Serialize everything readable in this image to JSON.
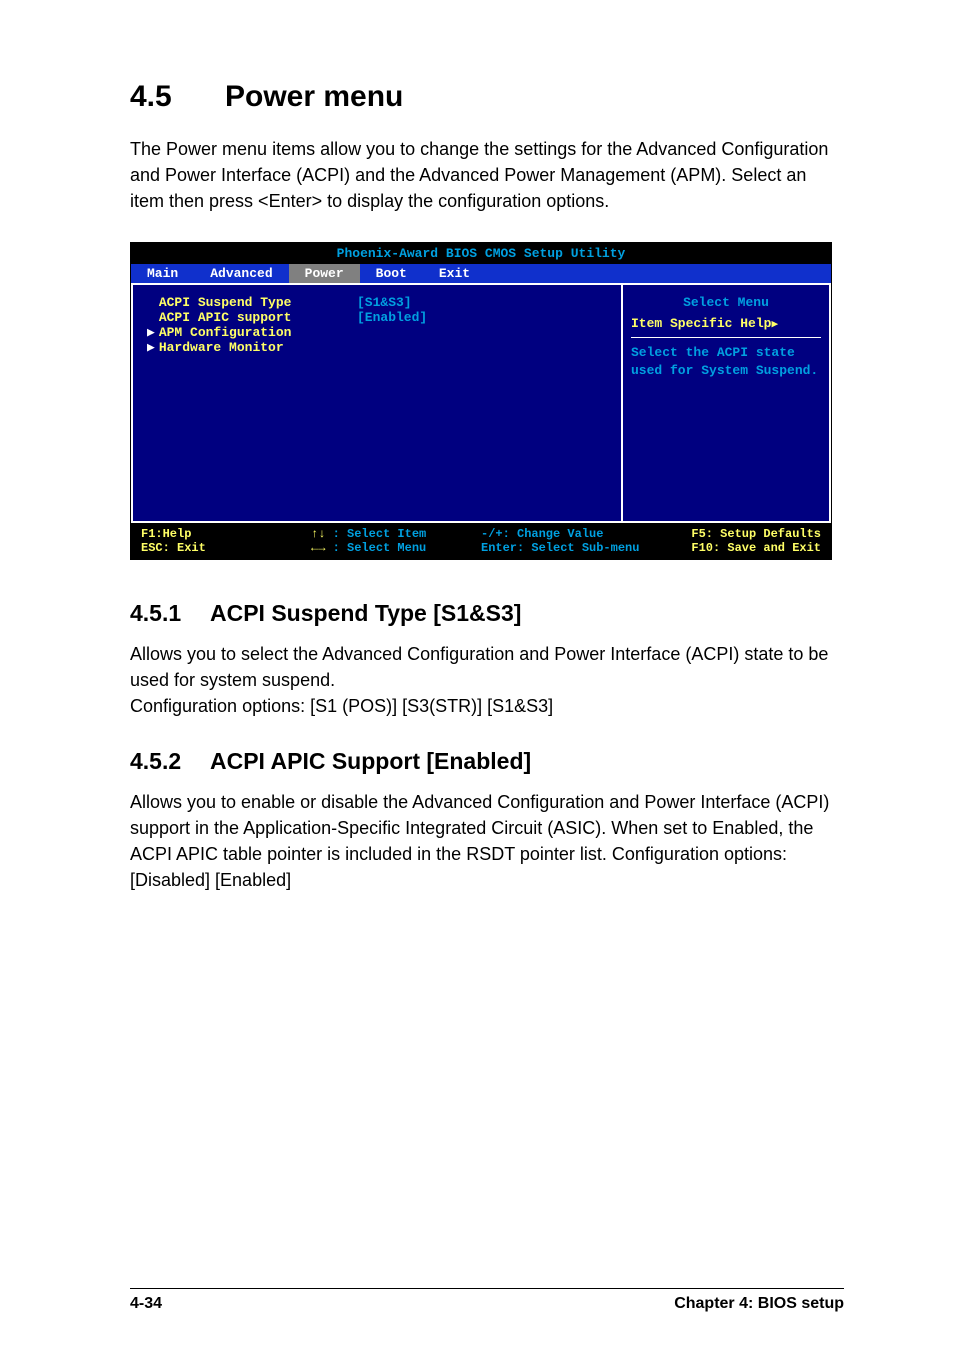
{
  "section": {
    "num": "4.5",
    "title": "Power menu"
  },
  "intro": "The Power menu items allow you to change the settings for the Advanced Configuration and Power Interface (ACPI) and the Advanced Power Management (APM). Select an item then press <Enter> to display the configuration options.",
  "bios": {
    "title": "Phoenix-Award BIOS CMOS Setup Utility",
    "tabs": [
      "Main",
      "Advanced",
      "Power",
      "Boot",
      "Exit"
    ],
    "active_tab": "Power",
    "items": [
      {
        "label": "ACPI Suspend Type",
        "value": "[S1&S3]",
        "arrow": false
      },
      {
        "label": "ACPI APIC support",
        "value": "[Enabled]",
        "arrow": false
      },
      {
        "label": "APM Configuration",
        "value": "",
        "arrow": true
      },
      {
        "label": "Hardware Monitor",
        "value": "",
        "arrow": true
      }
    ],
    "help": {
      "title": "Select Menu",
      "subtitle": "Item Specific Help",
      "text": "Select the ACPI state used for System Suspend."
    },
    "footer": {
      "c1a": "F1:Help",
      "c1b": "ESC: Exit",
      "c2a": ": Select Item",
      "c2b": ": Select Menu",
      "c3a": "-/+: Change Value",
      "c3b": "Enter: Select Sub-menu",
      "c4a": "F5: Setup Defaults",
      "c4b": "F10: Save and Exit"
    }
  },
  "sub1": {
    "num": "4.5.1",
    "title": "ACPI Suspend Type [S1&S3]",
    "body": "Allows you to select the Advanced Configuration and Power Interface (ACPI) state to be used for system suspend.\nConfiguration options: [S1 (POS)] [S3(STR)] [S1&S3]"
  },
  "sub2": {
    "num": "4.5.2",
    "title": "ACPI APIC Support [Enabled]",
    "body": "Allows you to enable or disable the Advanced Configuration and Power Interface (ACPI) support in the Application-Specific Integrated Circuit (ASIC). When set to Enabled, the ACPI APIC table pointer is included in the RSDT pointer list. Configuration options: [Disabled] [Enabled]"
  },
  "footer": {
    "page": "4-34",
    "chapter": "Chapter 4: BIOS setup"
  }
}
